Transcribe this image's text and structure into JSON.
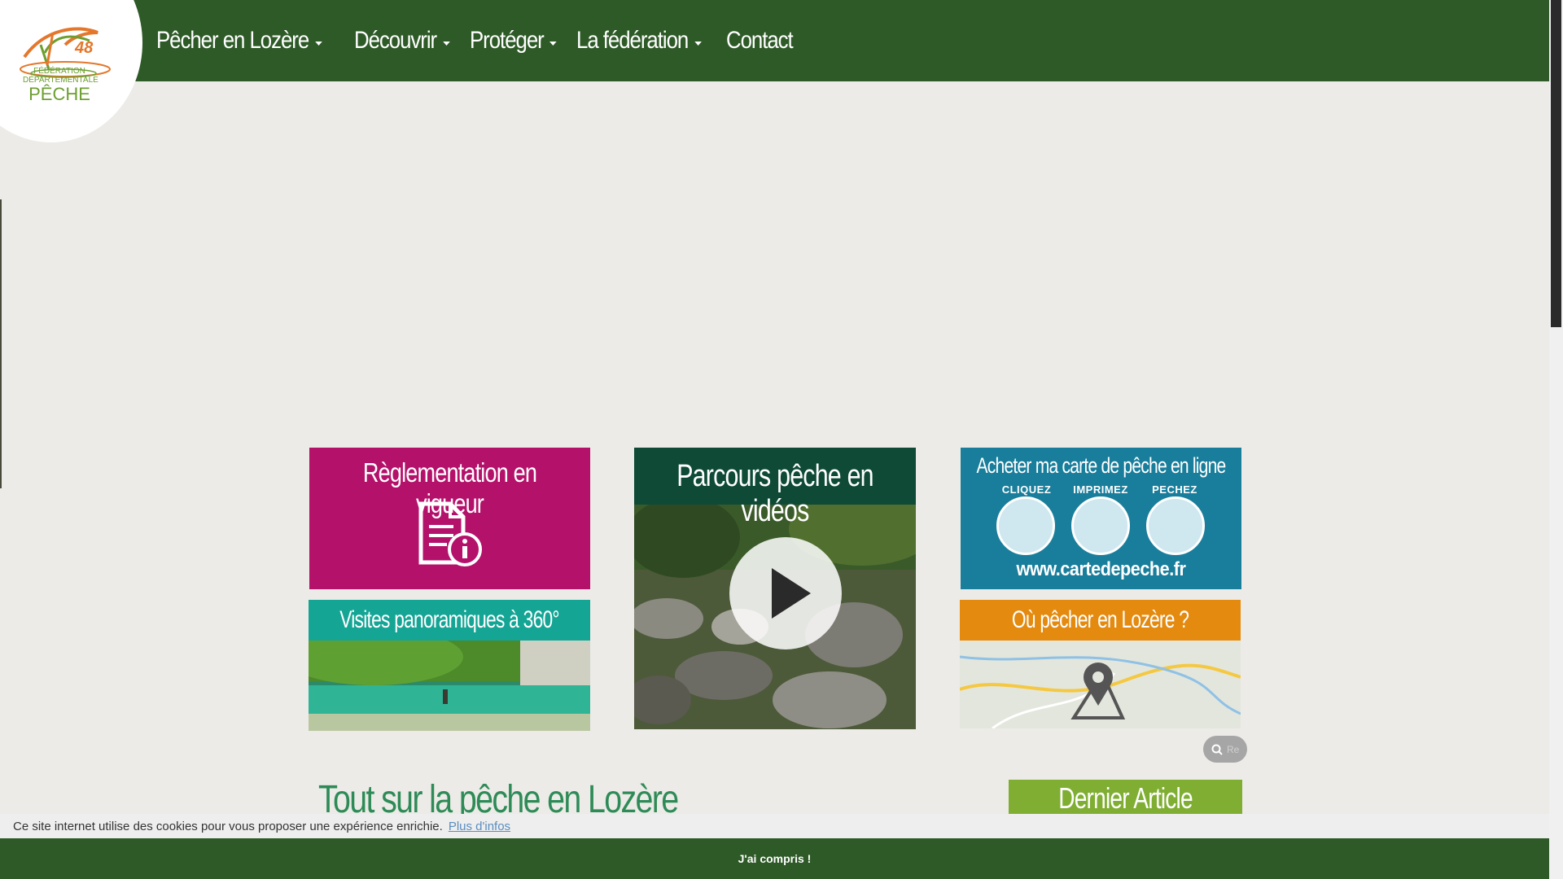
{
  "brand": {
    "logo_number": "48",
    "logo_line1": "FÉDÉRATION",
    "logo_line2": "DÉPARTEMENTALE",
    "logo_line3": "PÊCHE",
    "colors": {
      "green_dark": "#2e5a27",
      "magenta": "#b4116b",
      "teal": "#15a595",
      "orange": "#e48a0f",
      "blue": "#197e9b",
      "lime": "#7fae32"
    }
  },
  "nav": {
    "items": [
      {
        "label": "Pêcher en Lozère",
        "has_dropdown": true
      },
      {
        "label": "Découvrir",
        "has_dropdown": true
      },
      {
        "label": "Protéger",
        "has_dropdown": true
      },
      {
        "label": "La fédération",
        "has_dropdown": true
      },
      {
        "label": "Contact",
        "has_dropdown": false
      }
    ]
  },
  "tiles": {
    "reglementation": {
      "title": "Règlementation en vigueur",
      "icon": "document-info-icon"
    },
    "videos": {
      "title": "Parcours pêche en vidéos",
      "icon": "play-icon"
    },
    "carte": {
      "title": "Acheter ma carte de pêche en ligne",
      "steps": [
        "CLIQUEZ",
        "IMPRIMEZ",
        "PECHEZ"
      ],
      "url": "www.cartedepeche.fr"
    },
    "panoramiques": {
      "title": "Visites panoramiques à 360°"
    },
    "ou_pecher": {
      "title": "Où pêcher en Lozère ?",
      "icon": "map-pin-icon"
    }
  },
  "search": {
    "placeholder": "Re"
  },
  "main": {
    "section_title": "Tout sur la pêche en Lozère",
    "last_article_label": "Dernier Article"
  },
  "cookie": {
    "message": "Ce site internet utilise des cookies pour vous proposer une expérience enrichie.",
    "more_info": "Plus d'infos",
    "accept": "J'ai compris !"
  }
}
